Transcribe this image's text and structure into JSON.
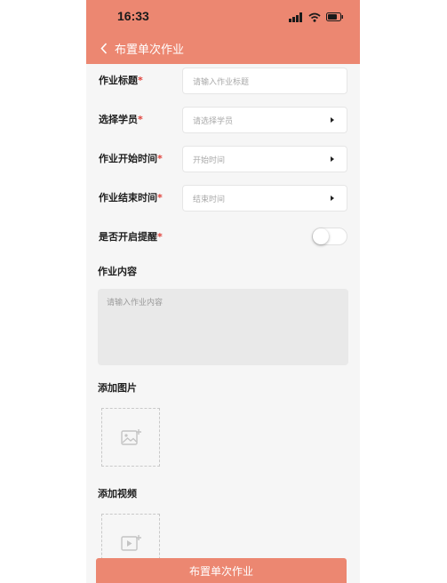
{
  "status_bar": {
    "time": "16:33"
  },
  "nav": {
    "title": "布置单次作业"
  },
  "form": {
    "title": {
      "label": "作业标题",
      "required_mark": "*",
      "placeholder": "请输入作业标题"
    },
    "students": {
      "label": "选择学员",
      "required_mark": "*",
      "placeholder": "请选择学员"
    },
    "start_time": {
      "label": "作业开始时间",
      "required_mark": "*",
      "placeholder": "开始时间"
    },
    "end_time": {
      "label": "作业结束时间",
      "required_mark": "*",
      "placeholder": "结束时间"
    },
    "reminder": {
      "label": "是否开启提醒",
      "required_mark": "*",
      "enabled": false
    },
    "content": {
      "label": "作业内容",
      "placeholder": "请输入作业内容"
    },
    "add_image": {
      "label": "添加图片"
    },
    "add_video": {
      "label": "添加视频"
    }
  },
  "submit": {
    "label": "布置单次作业"
  },
  "colors": {
    "accent": "#ec8771",
    "required": "#e0413a",
    "background": "#f6f6f6"
  },
  "icons": [
    "chevron-left-icon",
    "signal-icon",
    "wifi-icon",
    "battery-icon",
    "caret-right-icon",
    "add-image-icon",
    "add-video-icon"
  ]
}
